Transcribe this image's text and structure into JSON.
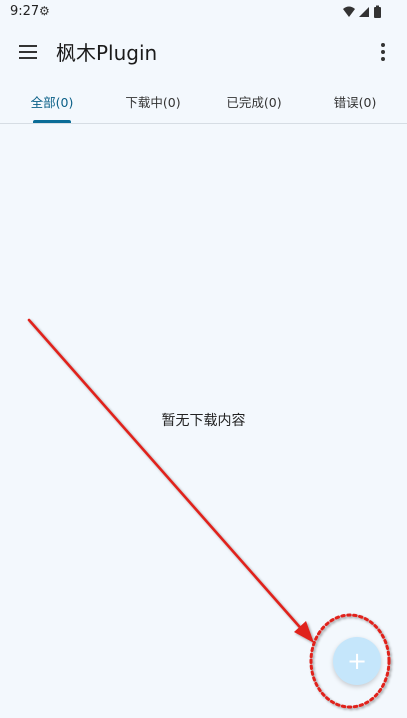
{
  "status_bar": {
    "time": "9:27",
    "icons": [
      "settings-gear-icon",
      "wifi-icon",
      "signal-icon",
      "battery-icon"
    ]
  },
  "app_bar": {
    "title": "枫木Plugin",
    "menu_icon": "hamburger-menu-icon",
    "more_icon": "more-vertical-icon"
  },
  "tabs": [
    {
      "label": "全部(0)",
      "active": true
    },
    {
      "label": "下载中(0)",
      "active": false
    },
    {
      "label": "已完成(0)",
      "active": false
    },
    {
      "label": "错误(0)",
      "active": false
    }
  ],
  "empty_state": {
    "text": "暂无下载内容"
  },
  "fab": {
    "icon": "plus-icon",
    "symbol": "+"
  },
  "colors": {
    "background": "#f3f8fd",
    "accent": "#0a6c97",
    "fab": "#c5e6fb",
    "annotation": "#e0201a"
  }
}
